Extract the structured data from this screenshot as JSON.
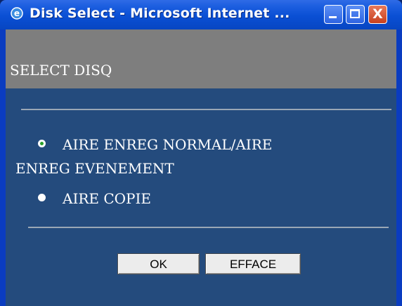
{
  "window": {
    "title": "Disk Select - Microsoft Internet ...",
    "icon": "ie-icon",
    "controls": {
      "minimize_icon": "minimize-icon",
      "maximize_icon": "maximize-icon",
      "close_icon": "close-icon",
      "close_glyph": "X"
    }
  },
  "page": {
    "header": "SELECT DISQ",
    "options": [
      {
        "label_line1": "AIRE ENREG NORMAL/AIRE",
        "label_line2": "ENREG EVENEMENT",
        "selected": true
      },
      {
        "label_line1": "AIRE COPIE",
        "selected": false
      }
    ],
    "buttons": {
      "ok": "OK",
      "clear": "EFFACE"
    }
  },
  "colors": {
    "content_bg": "#244b7d",
    "header_bg": "#7e7e7e",
    "titlebar": "#0a4fd4",
    "radio_selected": "#2aa02a"
  }
}
